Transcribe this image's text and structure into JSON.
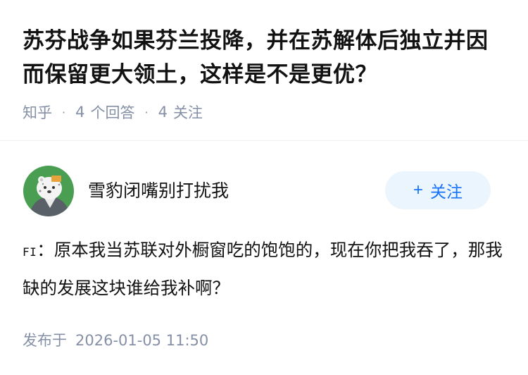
{
  "question": {
    "title": "苏芬战争如果芬兰投降，并在苏解体后独立并因而保留更大领土，这样是不是更优？",
    "source": "知乎",
    "separator": "·",
    "answers_count": "4",
    "answers_label": "个回答",
    "followers_count": "4",
    "followers_label": "关注"
  },
  "answer": {
    "author_name": "雪豹闭嘴别打扰我",
    "follow_button": {
      "icon": "plus-icon",
      "label": "关注"
    },
    "content_prefix": "FI",
    "content_text": "：原本我当苏联对外橱窗吃的饱饱的，现在你把我吞了，那我缺的发展这块谁给我补啊？",
    "publish_label": "发布于",
    "publish_time": "2026-01-05 11:50"
  },
  "colors": {
    "muted_text": "#8590a6",
    "accent_blue": "#1772f6",
    "follow_button_bg": "#ebf5fd",
    "avatar_bg": "#4a9e52"
  }
}
